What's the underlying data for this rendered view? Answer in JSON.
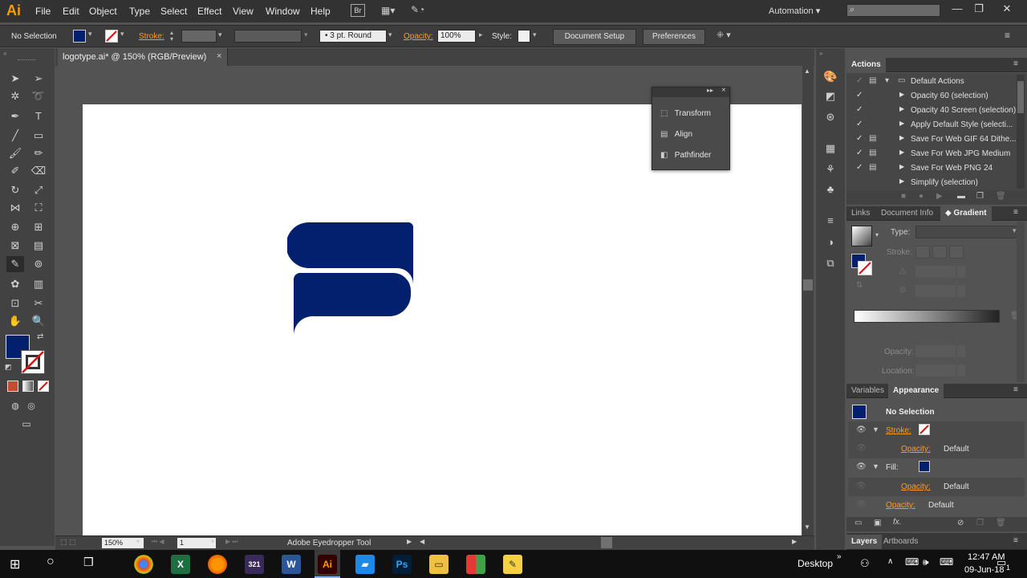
{
  "app": {
    "logo": "Ai",
    "menus": [
      "File",
      "Edit",
      "Object",
      "Type",
      "Select",
      "Effect",
      "View",
      "Window",
      "Help"
    ],
    "bridge_label": "Br",
    "workspace": "Automation",
    "search_placeholder": ""
  },
  "control_bar": {
    "selection_label": "No Selection",
    "stroke_label": "Stroke:",
    "brush_label": "3 pt. Round",
    "opacity_label": "Opacity:",
    "opacity_value": "100%",
    "style_label": "Style:",
    "document_setup_label": "Document Setup",
    "preferences_label": "Preferences"
  },
  "document": {
    "tab_title": "logotype.ai* @ 150% (RGB/Preview)",
    "zoom": "150%",
    "artboard_number": "1",
    "status_text": "Adobe Eyedropper Tool",
    "logo_color": "#03206e"
  },
  "float_panel": {
    "items": [
      "Transform",
      "Align",
      "Pathfinder"
    ]
  },
  "actions_panel": {
    "title": "Actions",
    "set_name": "Default Actions",
    "items": [
      "Opacity 60 (selection)",
      "Opacity 40 Screen (selection)",
      "Apply Default Style (selecti...",
      "Save For Web GIF 64 Dithe...",
      "Save For Web JPG Medium",
      "Save For Web PNG 24",
      "Simplify (selection)"
    ]
  },
  "gradient_panel": {
    "tabs": [
      "Links",
      "Document Info",
      "Gradient"
    ],
    "type_label": "Type:",
    "stroke_label": "Stroke:",
    "opacity_label": "Opacity:",
    "location_label": "Location:"
  },
  "appearance_panel": {
    "tabs": [
      "Variables",
      "Appearance"
    ],
    "header": "No Selection",
    "stroke_label": "Stroke:",
    "fill_label": "Fill:",
    "opacity_label": "Opacity:",
    "default_label": "Default",
    "fill_color": "#03206e"
  },
  "layers_tabs": [
    "Layers",
    "Artboards"
  ],
  "taskbar": {
    "desktop_label": "Desktop",
    "time": "12:47 AM",
    "date": "09-Jun-18",
    "notification_count": "1"
  }
}
